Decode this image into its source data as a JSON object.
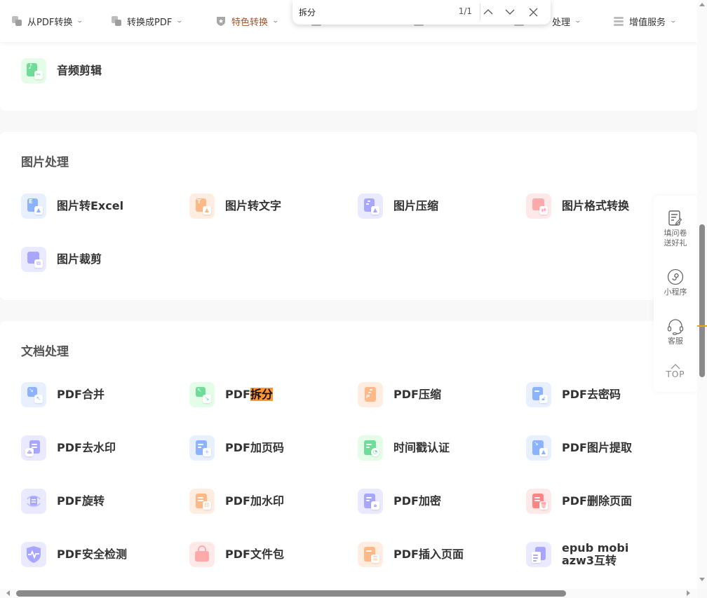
{
  "nav": {
    "items": [
      {
        "label": "从PDF转换",
        "icon": "pdf-from-icon",
        "active": false
      },
      {
        "label": "转换成PDF",
        "icon": "pdf-to-icon",
        "active": false
      },
      {
        "label": "特色转换",
        "icon": "star-shield-icon",
        "active": true
      },
      {
        "label": "处理",
        "icon": "process-icon",
        "active": false
      },
      {
        "label": "增值服务",
        "icon": "list-icon",
        "active": false
      }
    ]
  },
  "findbar": {
    "query": "拆分",
    "count": "1/1",
    "prev_icon": "chevron-up-icon",
    "next_icon": "chevron-down-icon",
    "close_icon": "close-icon"
  },
  "sections": {
    "audio": {
      "tools": [
        {
          "label": "音频剪辑",
          "icon": "audio-cut-icon"
        }
      ]
    },
    "image": {
      "title": "图片处理",
      "tools": [
        {
          "label": "图片转Excel",
          "icon": "image-to-excel-icon"
        },
        {
          "label": "图片转文字",
          "icon": "image-to-text-icon"
        },
        {
          "label": "图片压缩",
          "icon": "image-compress-icon"
        },
        {
          "label": "图片格式转换",
          "icon": "image-format-icon"
        },
        {
          "label": "图片裁剪",
          "icon": "image-crop-icon"
        }
      ]
    },
    "document": {
      "title": "文档处理",
      "tools": [
        {
          "label": "PDF合并",
          "icon": "pdf-merge-icon"
        },
        {
          "label_prefix": "PDF",
          "label_highlight": "拆分",
          "icon": "pdf-split-icon"
        },
        {
          "label": "PDF压缩",
          "icon": "pdf-compress-icon"
        },
        {
          "label": "PDF去密码",
          "icon": "pdf-unlock-icon"
        },
        {
          "label": "PDF去水印",
          "icon": "pdf-remove-watermark-icon"
        },
        {
          "label": "PDF加页码",
          "icon": "pdf-page-number-icon"
        },
        {
          "label": "时间戳认证",
          "icon": "timestamp-icon"
        },
        {
          "label": "PDF图片提取",
          "icon": "pdf-image-extract-icon"
        },
        {
          "label": "PDF旋转",
          "icon": "pdf-rotate-icon"
        },
        {
          "label": "PDF加水印",
          "icon": "pdf-add-watermark-icon"
        },
        {
          "label": "PDF加密",
          "icon": "pdf-encrypt-icon"
        },
        {
          "label": "PDF删除页面",
          "icon": "pdf-delete-page-icon"
        },
        {
          "label": "PDF安全检测",
          "icon": "pdf-security-icon"
        },
        {
          "label": "PDF文件包",
          "icon": "pdf-package-icon"
        },
        {
          "label": "PDF插入页面",
          "icon": "pdf-insert-page-icon"
        },
        {
          "label_line1": "epub mobi",
          "label_line2": "azw3互转",
          "icon": "ebook-convert-icon"
        }
      ]
    }
  },
  "float_panel": {
    "survey": {
      "line1": "填问卷",
      "line2": "送好礼"
    },
    "miniapp": "小程序",
    "service": "客服",
    "top": "TOP"
  },
  "colors": {
    "active_nav": "#a0522d",
    "highlight": "#ff9632",
    "green": "#6fdc9a",
    "blue": "#8cb3ff",
    "orange": "#ffb987",
    "purple": "#a9a6ff",
    "red": "#ff8585"
  }
}
